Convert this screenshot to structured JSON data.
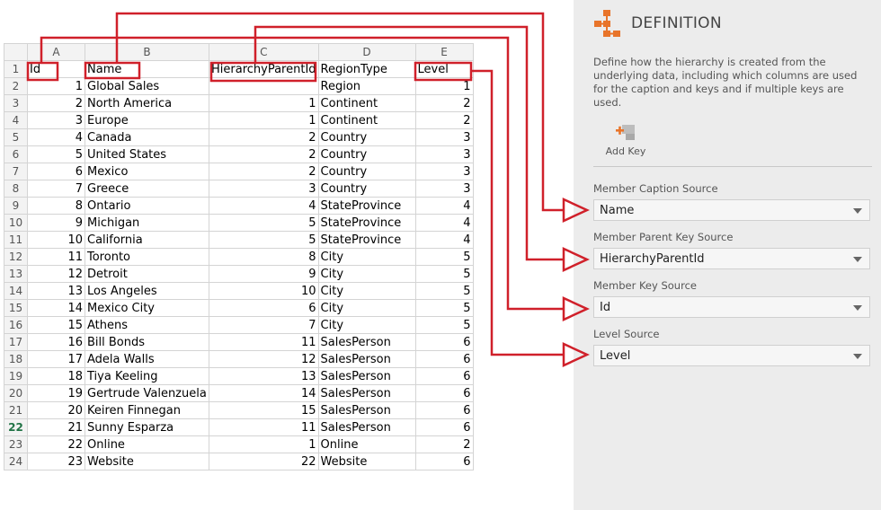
{
  "spreadsheet": {
    "columns": [
      "A",
      "B",
      "C",
      "D",
      "E"
    ],
    "header": [
      "Id",
      "Name",
      "HierarchyParentId",
      "RegionType",
      "Level"
    ],
    "selected_row": 22,
    "rows": [
      [
        "1",
        "Global Sales",
        "",
        "Region",
        "1"
      ],
      [
        "2",
        "North America",
        "1",
        "Continent",
        "2"
      ],
      [
        "3",
        "Europe",
        "1",
        "Continent",
        "2"
      ],
      [
        "4",
        "Canada",
        "2",
        "Country",
        "3"
      ],
      [
        "5",
        "United States",
        "2",
        "Country",
        "3"
      ],
      [
        "6",
        "Mexico",
        "2",
        "Country",
        "3"
      ],
      [
        "7",
        "Greece",
        "3",
        "Country",
        "3"
      ],
      [
        "8",
        "Ontario",
        "4",
        "StateProvince",
        "4"
      ],
      [
        "9",
        "Michigan",
        "5",
        "StateProvince",
        "4"
      ],
      [
        "10",
        "California",
        "5",
        "StateProvince",
        "4"
      ],
      [
        "11",
        "Toronto",
        "8",
        "City",
        "5"
      ],
      [
        "12",
        "Detroit",
        "9",
        "City",
        "5"
      ],
      [
        "13",
        "Los Angeles",
        "10",
        "City",
        "5"
      ],
      [
        "14",
        "Mexico City",
        "6",
        "City",
        "5"
      ],
      [
        "15",
        "Athens",
        "7",
        "City",
        "5"
      ],
      [
        "16",
        "Bill Bonds",
        "11",
        "SalesPerson",
        "6"
      ],
      [
        "17",
        "Adela Walls",
        "12",
        "SalesPerson",
        "6"
      ],
      [
        "18",
        "Tiya Keeling",
        "13",
        "SalesPerson",
        "6"
      ],
      [
        "19",
        "Gertrude Valenzuela",
        "14",
        "SalesPerson",
        "6"
      ],
      [
        "20",
        "Keiren Finnegan",
        "15",
        "SalesPerson",
        "6"
      ],
      [
        "21",
        "Sunny Esparza",
        "11",
        "SalesPerson",
        "6"
      ],
      [
        "22",
        "Online",
        "1",
        "Online",
        "2"
      ],
      [
        "23",
        "Website",
        "22",
        "Website",
        "6"
      ]
    ]
  },
  "panel": {
    "icon": "hierarchy-icon",
    "title": "DEFINITION",
    "description": "Define how the hierarchy is created from the underlying data, including which columns are used for the caption and keys and if multiple keys are used.",
    "add_key_label": "Add Key",
    "add_key_icon": "add-key-icon",
    "fields": [
      {
        "label": "Member Caption Source",
        "value": "Name"
      },
      {
        "label": "Member Parent Key Source",
        "value": "HierarchyParentId"
      },
      {
        "label": "Member Key Source",
        "value": "Id"
      },
      {
        "label": "Level Source",
        "value": "Level"
      }
    ]
  },
  "colors": {
    "annotation": "#d0202a",
    "accent_orange": "#e8742a",
    "selected_row_green": "#217346"
  }
}
